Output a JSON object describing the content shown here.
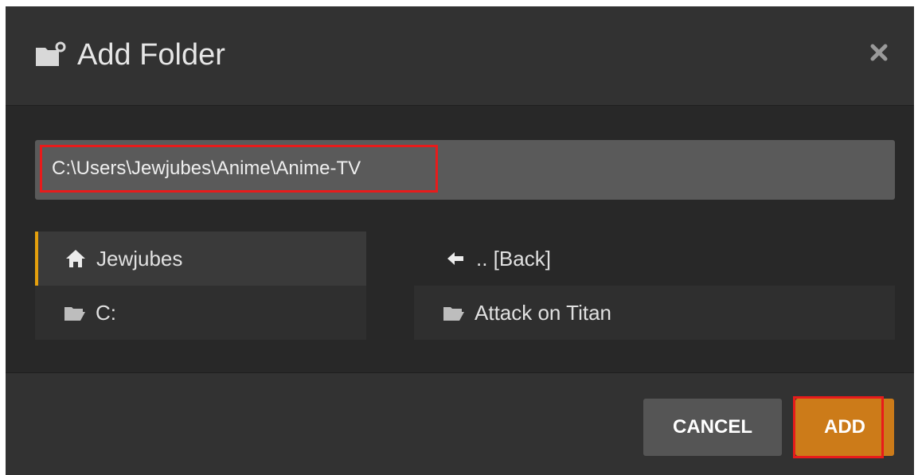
{
  "dialog": {
    "title": "Add Folder",
    "close_icon": "close-icon"
  },
  "path": {
    "value": "C:\\Users\\Jewjubes\\Anime\\Anime-TV"
  },
  "left_list": [
    {
      "label": "Jewjubes",
      "icon": "home-icon",
      "selected": true
    },
    {
      "label": "C:",
      "icon": "folder-open-icon",
      "selected": false
    }
  ],
  "right_list": [
    {
      "label": ".. [Back]",
      "icon": "arrow-left-icon"
    },
    {
      "label": "Attack on Titan",
      "icon": "folder-open-icon"
    }
  ],
  "footer": {
    "cancel_label": "CANCEL",
    "add_label": "ADD"
  },
  "colors": {
    "accent": "#e5a00d",
    "add_button": "#cc7b19",
    "highlight_outline": "#e81b1b"
  }
}
